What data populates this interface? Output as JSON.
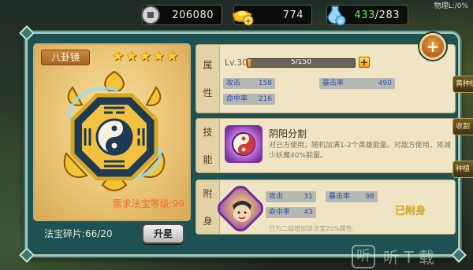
{
  "status_bar": {
    "text": "物理L:/0%"
  },
  "resources": {
    "silver": "206080",
    "gold": "774",
    "stamina_current": "433",
    "stamina_max": "283",
    "stamina_sep": "/"
  },
  "item": {
    "name": "八卦镜",
    "stars": [
      "★",
      "★",
      "★",
      "★",
      "★"
    ],
    "requirement": "需求法宝等级:99",
    "fragments": "法宝碎片:66/20",
    "upgrade_label": "升星"
  },
  "attributes": {
    "tab": [
      "属",
      "性"
    ],
    "level_label": "Lv.30",
    "exp_text": "5/150",
    "exp_fraction": 0.033,
    "plus_label": "+",
    "stats": [
      {
        "key": "攻击",
        "value": "158"
      },
      {
        "key": "暴击率",
        "value": "490"
      },
      {
        "key": "命中率",
        "value": "216"
      }
    ]
  },
  "skill": {
    "tab": [
      "技",
      "能"
    ],
    "name": "阴阳分割",
    "description": "对己方使用，随机加满1-2个英雄能量。对敌方使用，将减少妖魔40%能量。"
  },
  "attach": {
    "tab": [
      "附",
      "身"
    ],
    "stats": [
      {
        "key": "攻击",
        "value": "31"
      },
      {
        "key": "暴击率",
        "value": "98"
      },
      {
        "key": "命中率",
        "value": "43"
      }
    ],
    "status": "已附身",
    "note": "已为二娃增加该法宝20%属性:"
  },
  "expand_label": "+",
  "edge_tabs": [
    "黄种植",
    "收割",
    "种植"
  ],
  "watermark": {
    "logo": "听",
    "text": "听 T 载"
  },
  "colors": {
    "accent_gold": "#ffd12a",
    "stat_blue": "#2e4fa8",
    "attached_gold": "#e6b21a"
  }
}
